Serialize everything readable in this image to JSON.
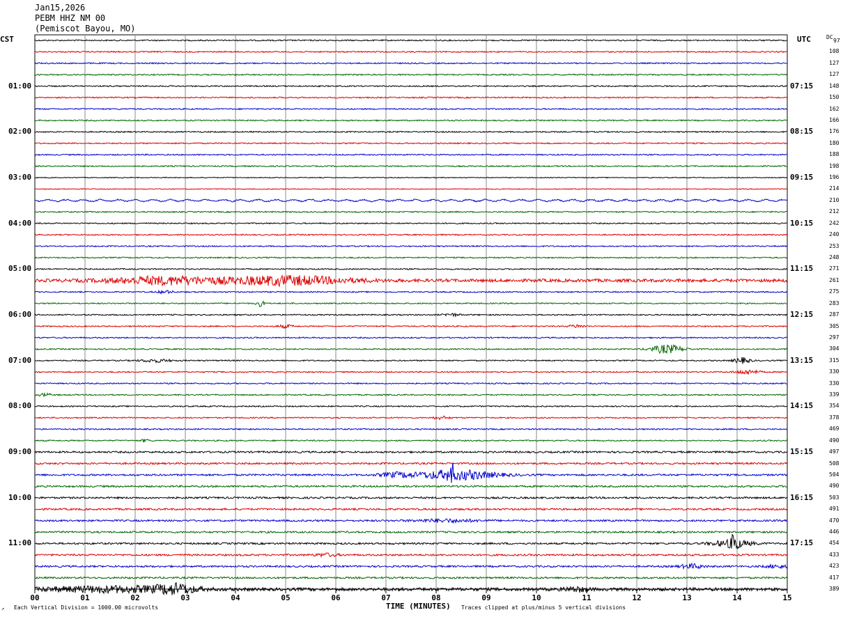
{
  "header": {
    "date": "Jan15,2026",
    "station": "PEBM HHZ NM 00",
    "location": "(Pemiscot Bayou, MO)"
  },
  "left_timezone": "CST",
  "right_timezone": "UTC",
  "dc_label": "DC",
  "left_hour_labels": [
    "01:00",
    "02:00",
    "03:00",
    "04:00",
    "05:00",
    "06:00",
    "07:00",
    "08:00",
    "09:00",
    "10:00",
    "11:00"
  ],
  "right_hour_labels": [
    "07:15",
    "08:15",
    "09:15",
    "10:15",
    "11:15",
    "12:15",
    "13:15",
    "14:15",
    "15:15",
    "16:15",
    "17:15"
  ],
  "dc_offsets": [
    "97",
    "108",
    "127",
    "127",
    "148",
    "150",
    "162",
    "166",
    "176",
    "180",
    "188",
    "198",
    "196",
    "214",
    "210",
    "212",
    "242",
    "240",
    "253",
    "248",
    "271",
    "261",
    "275",
    "283",
    "287",
    "305",
    "297",
    "304",
    "315",
    "330",
    "330",
    "339",
    "354",
    "378",
    "469",
    "490",
    "497",
    "508",
    "504",
    "490",
    "503",
    "491",
    "470",
    "446",
    "454",
    "433",
    "423",
    "417",
    "389"
  ],
  "x_ticks": [
    "00",
    "01",
    "02",
    "03",
    "04",
    "05",
    "06",
    "07",
    "08",
    "09",
    "10",
    "11",
    "12",
    "13",
    "14",
    "15"
  ],
  "x_axis_label": "TIME (MINUTES)",
  "footer_left": "Each Vertical Division = 1000.00 microvolts",
  "footer_right": "Traces clipped at plus/minus 5 vertical divisions",
  "trace_colors": [
    "#000000",
    "#dd0000",
    "#0000cc",
    "#006600"
  ]
}
